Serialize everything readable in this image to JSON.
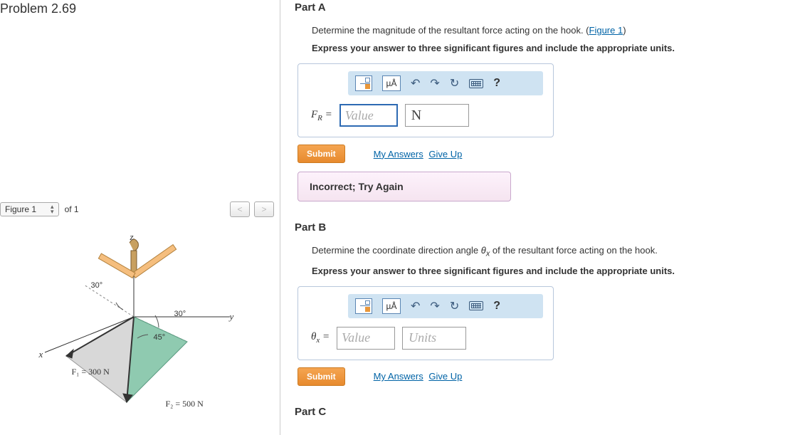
{
  "problem_title": "Problem 2.69",
  "figure": {
    "selector_label": "Figure 1",
    "of_label": "of 1",
    "prev": "<",
    "next": ">",
    "labels": {
      "z": "z",
      "x": "x",
      "y": "y",
      "a30a": "30°",
      "a30b": "30°",
      "a45": "45°",
      "f1": "F₁ = 300 N",
      "f2": "F₂ = 500 N"
    }
  },
  "partA": {
    "title": "Part A",
    "desc_pre": "Determine the magnitude of the resultant force acting on the hook. (",
    "desc_link": "Figure 1",
    "desc_post": ")",
    "instr": "Express your answer to three significant figures and include the appropriate units.",
    "toolbar": {
      "ua": "µÅ",
      "undo": "↶",
      "redo": "↷",
      "reset": "↻",
      "help": "?"
    },
    "var_html": "F<span class='sub'>R</span> =",
    "value_ph": "Value",
    "unit_val": "N",
    "submit": "Submit",
    "my_answers": "My Answers",
    "give_up": "Give Up",
    "feedback": "Incorrect; Try Again"
  },
  "partB": {
    "title": "Part B",
    "desc_html": "Determine the coordinate direction angle <i>θ<sub>x</sub></i> of the resultant force acting on the hook.",
    "instr": "Express your answer to three significant figures and include the appropriate units.",
    "toolbar": {
      "ua": "µÅ",
      "undo": "↶",
      "redo": "↷",
      "reset": "↻",
      "help": "?"
    },
    "var_html": "θ<span class='sub'>x</span> =",
    "value_ph": "Value",
    "unit_ph": "Units",
    "submit": "Submit",
    "my_answers": "My Answers",
    "give_up": "Give Up"
  },
  "partC": {
    "title": "Part C"
  }
}
